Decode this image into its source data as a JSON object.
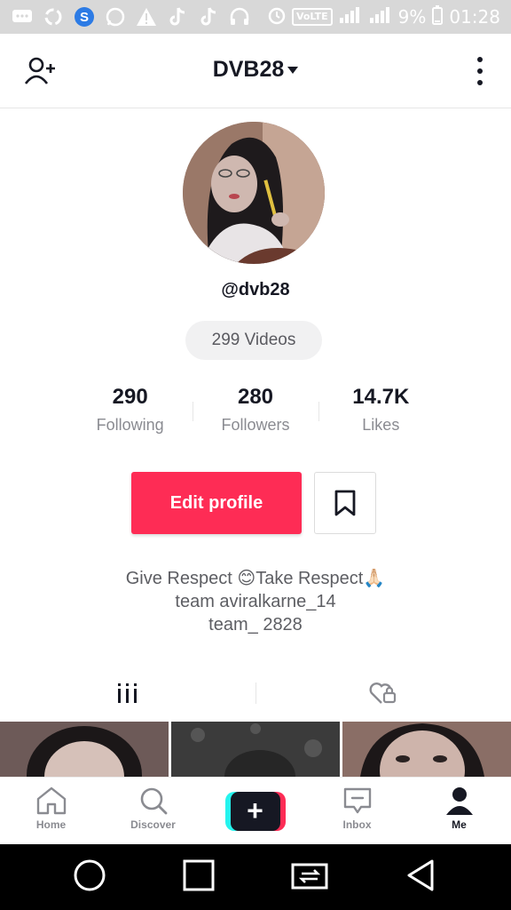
{
  "status_bar": {
    "battery": "9%",
    "time": "01:28",
    "volte": "VoLTE"
  },
  "header": {
    "title": "DVB28"
  },
  "profile": {
    "handle": "@dvb28",
    "videos_count": "299 Videos"
  },
  "stats": [
    {
      "value": "290",
      "label": "Following"
    },
    {
      "value": "280",
      "label": "Followers"
    },
    {
      "value": "14.7K",
      "label": "Likes"
    }
  ],
  "actions": {
    "edit_profile": "Edit profile"
  },
  "bio": {
    "line1": "Give Respect 😊Take Respect🙏🏻",
    "line2": "team aviralkarne_14",
    "line3": "team_ 2828"
  },
  "bottom_nav": {
    "home": "Home",
    "discover": "Discover",
    "create": "+",
    "inbox": "Inbox",
    "me": "Me"
  },
  "colors": {
    "accent": "#fe2c55",
    "cyan": "#25f4ee",
    "text": "#161823",
    "muted": "#8a8b91"
  }
}
